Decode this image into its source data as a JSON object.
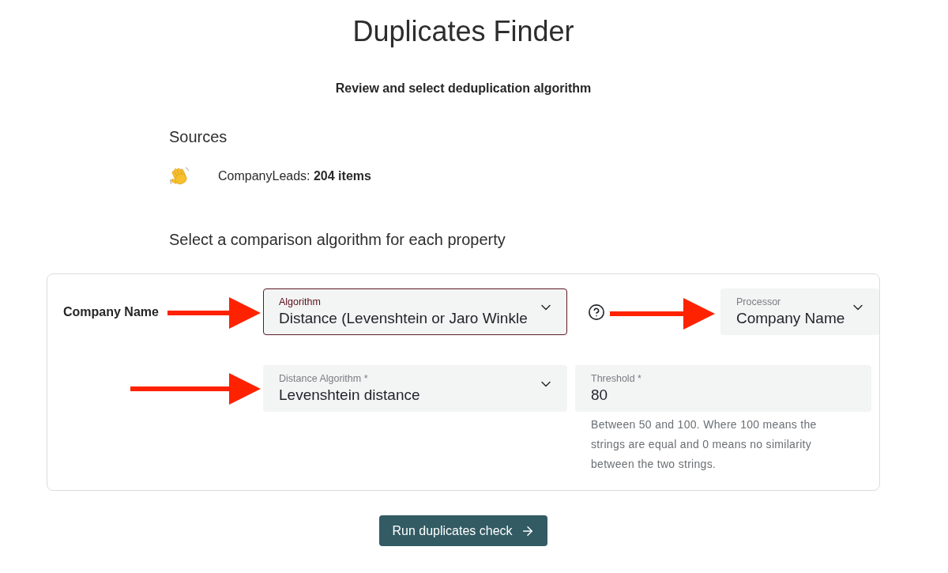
{
  "title": "Duplicates Finder",
  "subtitle": "Review and select deduplication algorithm",
  "sources": {
    "heading": "Sources",
    "items": [
      {
        "text": "CompanyLeads: **204 items**"
      }
    ]
  },
  "properties_heading": "Select a comparison algorithm for each property",
  "properties": [
    {
      "name": "Company Name",
      "rows": [
        [
          {
            "kind": "select",
            "label": "Algorithm",
            "value": "Distance (Levenshtein or Jaro Winkle",
            "focused": true,
            "help": true
          },
          {
            "kind": "select",
            "label": "Processor",
            "value": "Company Name",
            "focused": false
          }
        ],
        [
          {
            "kind": "select",
            "label": "Distance Algorithm *",
            "value": "Levenshtein distance",
            "focused": false
          },
          {
            "kind": "text",
            "label": "Threshold *",
            "value": "80",
            "focused": false,
            "helper": "Between 50 and 100. Where 100 means the strings are equal and 0 means no similarity between the two strings."
          }
        ]
      ]
    }
  ],
  "run_button": {
    "label": "Run duplicates check"
  }
}
